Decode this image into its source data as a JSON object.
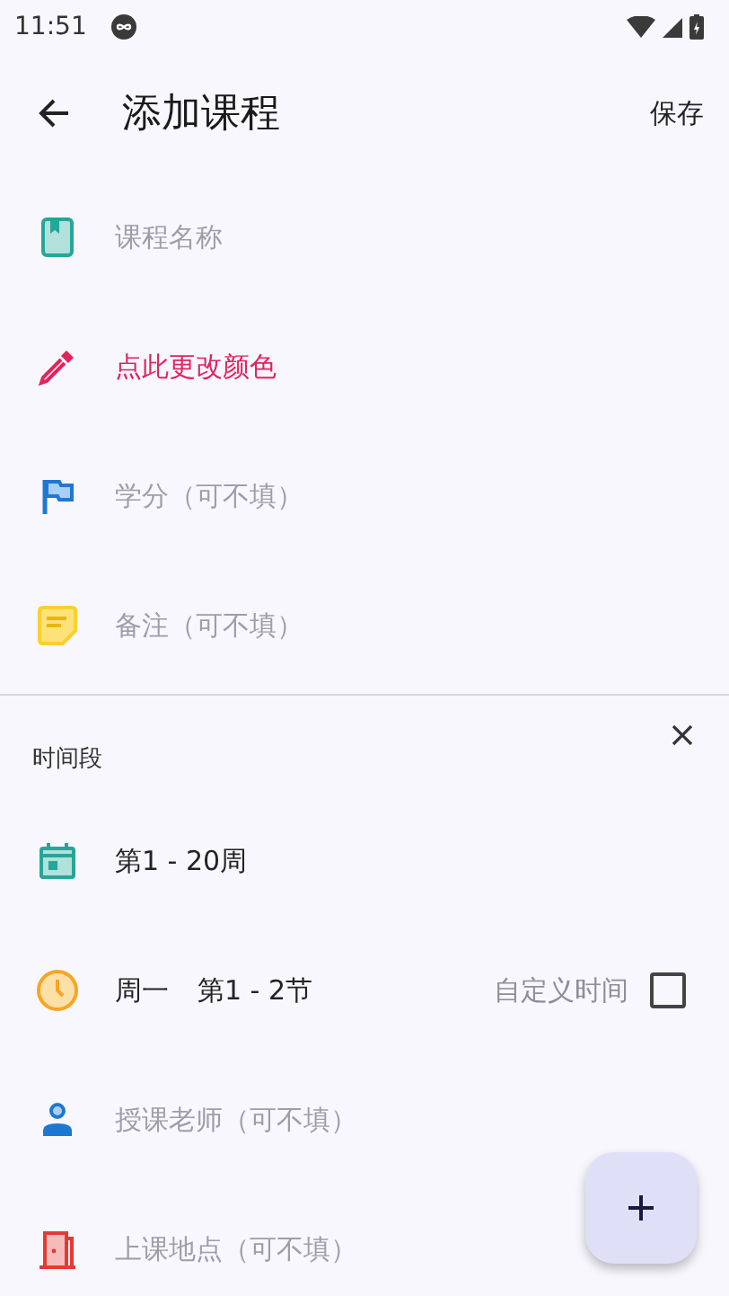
{
  "status_bar": {
    "time": "11:51"
  },
  "toolbar": {
    "title": "添加课程",
    "action": "保存"
  },
  "fields": [
    {
      "kind": "name",
      "placeholder": "课程名称"
    },
    {
      "kind": "color",
      "label": "点此更改颜色",
      "color": "#e0245e"
    },
    {
      "kind": "credit",
      "placeholder": "学分（可不填）"
    },
    {
      "kind": "note",
      "placeholder": "备注（可不填）"
    }
  ],
  "time_section": {
    "title": "时间段",
    "weeks": "第1 - 20周",
    "day": "周一",
    "periods": "第1 - 2节",
    "custom_time": {
      "label": "自定义时间",
      "checked": false
    },
    "teacher_placeholder": "授课老师（可不填）",
    "location_placeholder": "上课地点（可不填）"
  }
}
